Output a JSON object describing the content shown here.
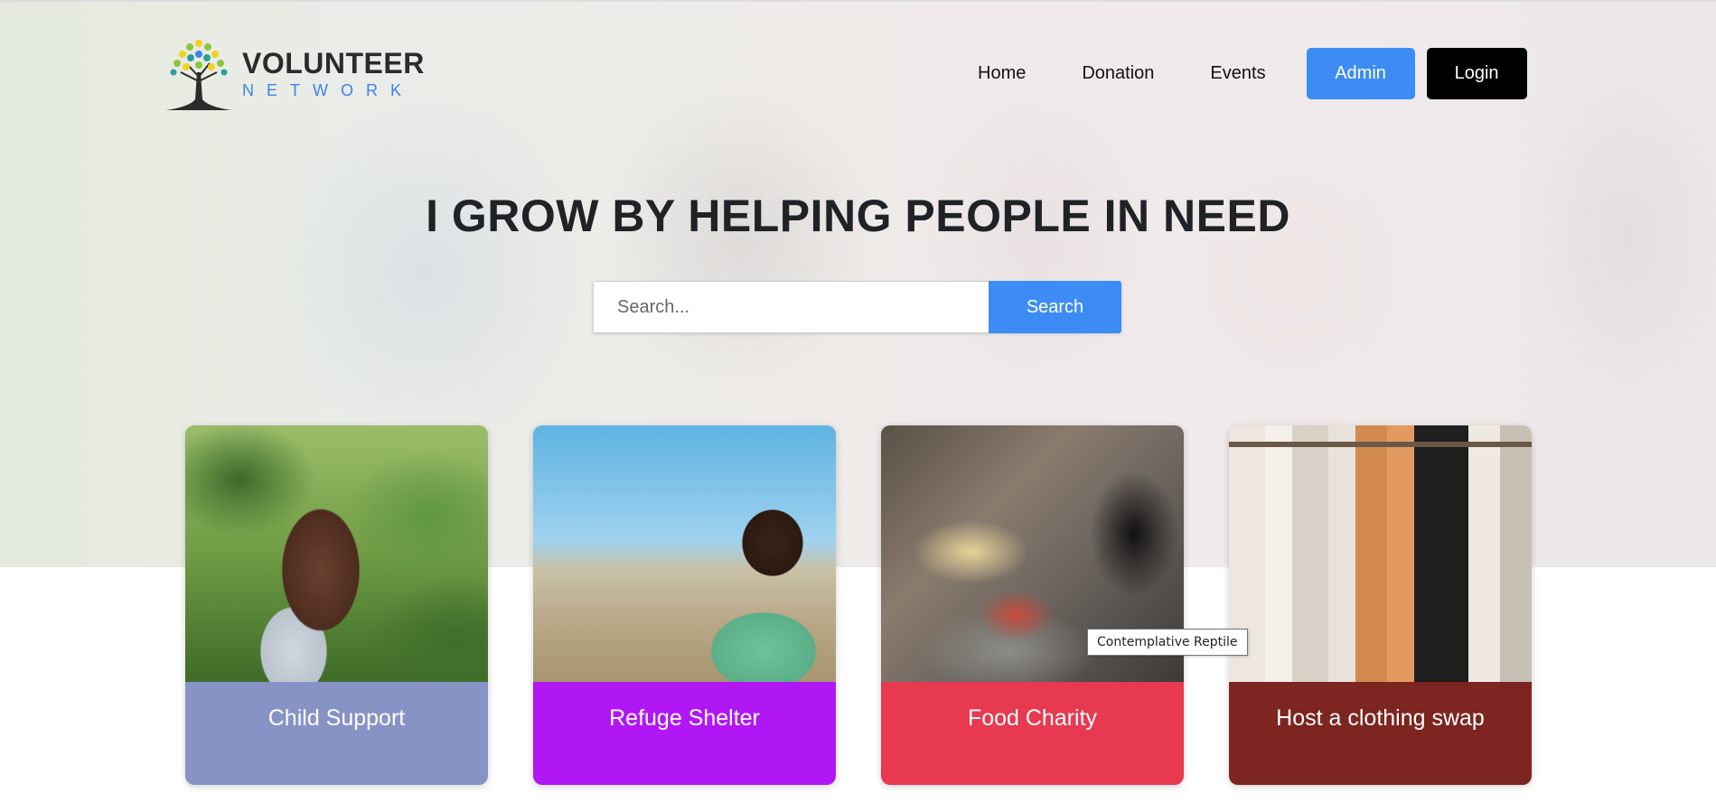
{
  "logo": {
    "title": "VOLUNTEER",
    "subtitle": "NETWORK"
  },
  "nav": {
    "links": [
      "Home",
      "Donation",
      "Events"
    ],
    "admin_label": "Admin",
    "login_label": "Login"
  },
  "hero": {
    "headline": "I GROW BY HELPING PEOPLE IN NEED"
  },
  "search": {
    "placeholder": "Search...",
    "button_label": "Search"
  },
  "cards": [
    {
      "label": "Child Support",
      "color": "#8793c5"
    },
    {
      "label": "Refuge Shelter",
      "color": "#b117f5"
    },
    {
      "label": "Food Charity",
      "color": "#e73950"
    },
    {
      "label": "Host a clothing swap",
      "color": "#7d2520"
    }
  ],
  "tooltip": "Contemplative Reptile",
  "colors": {
    "accent": "#3d8cf5",
    "login_bg": "#000000"
  }
}
